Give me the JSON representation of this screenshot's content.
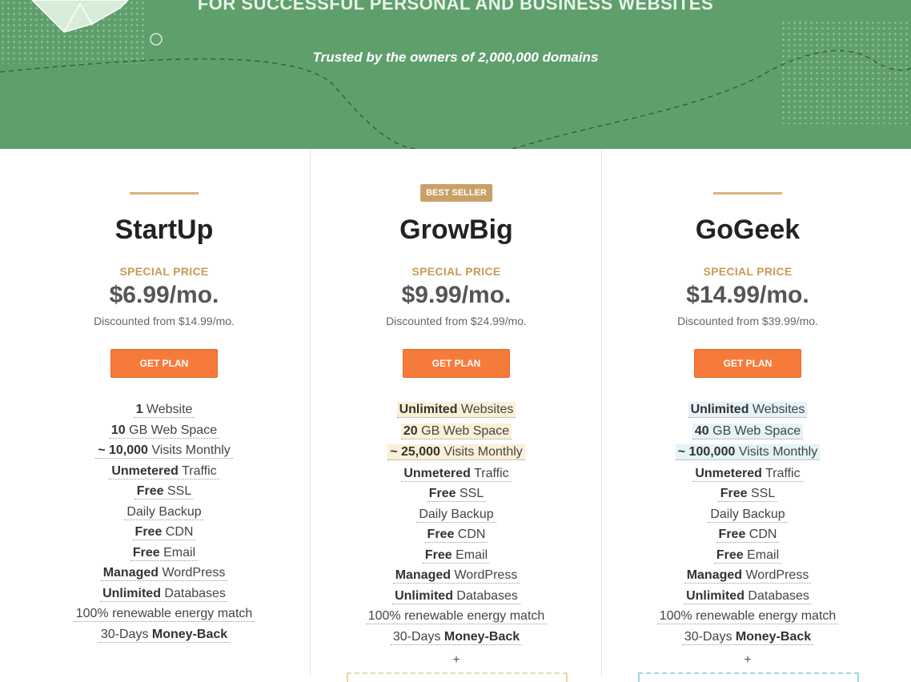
{
  "hero": {
    "headline": "FOR SUCCESSFUL PERSONAL AND BUSINESS WEBSITES",
    "subtitle": "Trusted by the owners of 2,000,000 domains",
    "bg_color": "#5f9f6c"
  },
  "plans": [
    {
      "name": "StartUp",
      "badge": "",
      "special_label": "SPECIAL PRICE",
      "price": "$6.99/mo.",
      "discounted": "Discounted from $14.99/mo.",
      "button": "GET PLAN",
      "features": [
        {
          "bold": "1",
          "text": " Website"
        },
        {
          "bold": "10",
          "text": " GB Web Space"
        },
        {
          "bold": "~ 10,000",
          "text": " Visits Monthly"
        },
        {
          "bold": "Unmetered",
          "text": " Traffic"
        },
        {
          "bold": "Free",
          "text": " SSL"
        },
        {
          "bold": "",
          "text": "Daily Backup"
        },
        {
          "bold": "Free",
          "text": " CDN"
        },
        {
          "bold": "Free",
          "text": " Email"
        },
        {
          "bold": "Managed",
          "text": " WordPress"
        },
        {
          "bold": "Unlimited",
          "text": " Databases"
        },
        {
          "bold": "",
          "text": "100% renewable energy match"
        },
        {
          "pre": "30-Days ",
          "bold": "Money-Back",
          "text": ""
        }
      ]
    },
    {
      "name": "GrowBig",
      "badge": "BEST SELLER",
      "special_label": "SPECIAL PRICE",
      "price": "$9.99/mo.",
      "discounted": "Discounted from $24.99/mo.",
      "button": "GET PLAN",
      "plus": "+",
      "features": [
        {
          "bold": "Unlimited",
          "text": " Websites",
          "hl": true
        },
        {
          "bold": "20",
          "text": " GB Web Space",
          "hl": true
        },
        {
          "bold": "~ 25,000",
          "text": " Visits Monthly",
          "hl": true
        },
        {
          "bold": "Unmetered",
          "text": " Traffic"
        },
        {
          "bold": "Free",
          "text": " SSL"
        },
        {
          "bold": "",
          "text": "Daily Backup"
        },
        {
          "bold": "Free",
          "text": " CDN"
        },
        {
          "bold": "Free",
          "text": " Email"
        },
        {
          "bold": "Managed",
          "text": " WordPress"
        },
        {
          "bold": "Unlimited",
          "text": " Databases"
        },
        {
          "bold": "",
          "text": "100% renewable energy match"
        },
        {
          "pre": "30-Days ",
          "bold": "Money-Back",
          "text": ""
        }
      ]
    },
    {
      "name": "GoGeek",
      "badge": "",
      "special_label": "SPECIAL PRICE",
      "price": "$14.99/mo.",
      "discounted": "Discounted from $39.99/mo.",
      "button": "GET PLAN",
      "plus": "+",
      "features": [
        {
          "bold": "Unlimited",
          "text": " Websites",
          "hl": true
        },
        {
          "bold": "40",
          "text": " GB Web Space",
          "hl": true
        },
        {
          "bold": "~ 100,000",
          "text": " Visits Monthly",
          "hl": true
        },
        {
          "bold": "Unmetered",
          "text": " Traffic"
        },
        {
          "bold": "Free",
          "text": " SSL"
        },
        {
          "bold": "",
          "text": "Daily Backup"
        },
        {
          "bold": "Free",
          "text": " CDN"
        },
        {
          "bold": "Free",
          "text": " Email"
        },
        {
          "bold": "Managed",
          "text": " WordPress"
        },
        {
          "bold": "Unlimited",
          "text": " Databases"
        },
        {
          "bold": "",
          "text": "100% renewable energy match"
        },
        {
          "pre": "30-Days ",
          "bold": "Money-Back",
          "text": ""
        }
      ]
    }
  ],
  "colors": {
    "accent_orange": "#f67b3b",
    "gold": "#c99a55",
    "growbig_highlight": "#faf0d6",
    "gogeek_highlight": "#e4f3f7"
  }
}
